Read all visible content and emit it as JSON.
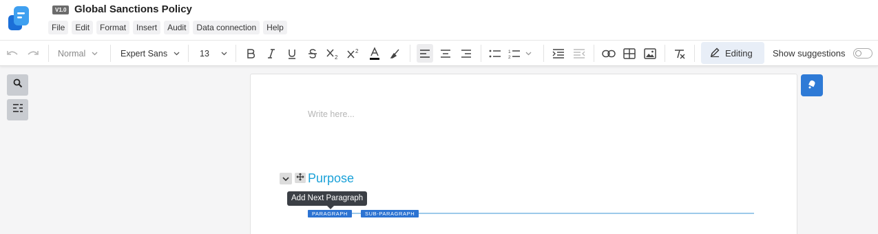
{
  "header": {
    "version_badge": "V1.0",
    "title": "Global Sanctions Policy",
    "menu": [
      "File",
      "Edit",
      "Format",
      "Insert",
      "Audit",
      "Data connection",
      "Help"
    ]
  },
  "toolbar": {
    "style_dropdown": "Normal",
    "font_dropdown": "Expert Sans",
    "size_dropdown": "13",
    "editing_label": "Editing",
    "show_suggestions_label": "Show suggestions",
    "show_suggestions_on": false
  },
  "editor": {
    "placeholder": "Write here...",
    "heading": "Purpose",
    "tooltip": "Add Next Paragraph",
    "chips": {
      "paragraph": "PARAGRAPH",
      "sub_paragraph": "SUB-PARAGRAPH"
    }
  },
  "colors": {
    "accent": "#2e7ad6",
    "heading": "#1aa1d8",
    "chip": "#2c73d2"
  }
}
